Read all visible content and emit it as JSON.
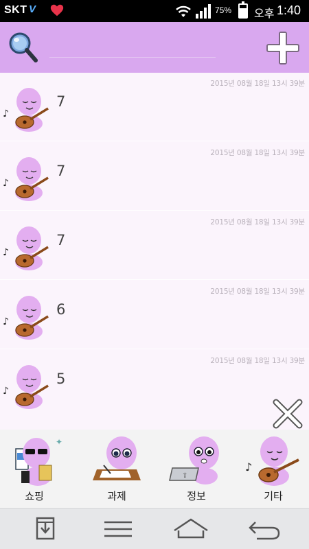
{
  "status_bar": {
    "carrier": "SKT",
    "volte": "V",
    "battery_percent": "75%",
    "battery_level": 0.75,
    "ampm": "오후",
    "time": "1:40"
  },
  "toolbar": {
    "search_placeholder": "",
    "search_icon": "magnifier-icon",
    "add_icon": "plus-icon"
  },
  "entries": [
    {
      "value": "7",
      "date": "2015년 08월 18일 13시 39분",
      "category_icon": "guitar-character-icon"
    },
    {
      "value": "7",
      "date": "2015년 08월 18일 13시 39분",
      "category_icon": "guitar-character-icon"
    },
    {
      "value": "7",
      "date": "2015년 08월 18일 13시 39분",
      "category_icon": "guitar-character-icon"
    },
    {
      "value": "6",
      "date": "2015년 08월 18일 13시 39분",
      "category_icon": "guitar-character-icon"
    },
    {
      "value": "5",
      "date": "2015년 08월 18일 13시 39분",
      "category_icon": "guitar-character-icon"
    }
  ],
  "categories": [
    {
      "label": "쇼핑",
      "icon": "shopping-character-icon"
    },
    {
      "label": "과제",
      "icon": "homework-character-icon"
    },
    {
      "label": "정보",
      "icon": "info-character-icon"
    },
    {
      "label": "기타",
      "icon": "guitar-character-icon"
    }
  ],
  "nav": {
    "icons": [
      "download-icon",
      "menu-icon",
      "home-icon",
      "back-icon"
    ]
  },
  "colors": {
    "toolbar": "#d9a8ef",
    "list_bg": "#fbf4fc",
    "character": "#e3aef0"
  }
}
